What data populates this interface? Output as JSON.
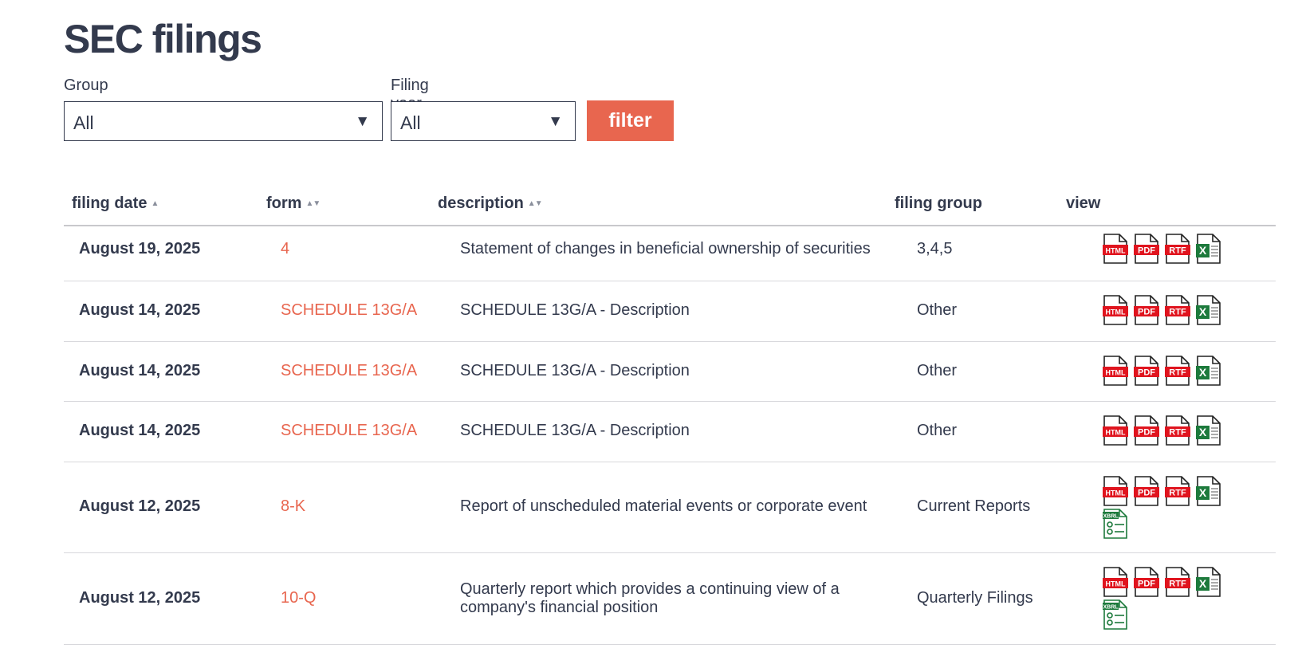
{
  "page": {
    "title": "SEC filings"
  },
  "filters": {
    "group_label": "Group",
    "group_value": "All",
    "year_label": "Filing year",
    "year_value": "All",
    "filter_button": "filter"
  },
  "table": {
    "headers": {
      "date": "filing date",
      "form": "form",
      "description": "description",
      "group": "filing group",
      "view": "view"
    },
    "rows": [
      {
        "date": "August 19, 2025",
        "form": "4",
        "description": "Statement of changes in beneficial ownership of securities",
        "group": "3,4,5",
        "views": [
          "HTML",
          "PDF",
          "RTF",
          "XLS"
        ]
      },
      {
        "date": "August 14, 2025",
        "form": "SCHEDULE 13G/A",
        "description": "SCHEDULE 13G/A - Description",
        "group": "Other",
        "views": [
          "HTML",
          "PDF",
          "RTF",
          "XLS"
        ]
      },
      {
        "date": "August 14, 2025",
        "form": "SCHEDULE 13G/A",
        "description": "SCHEDULE 13G/A - Description",
        "group": "Other",
        "views": [
          "HTML",
          "PDF",
          "RTF",
          "XLS"
        ]
      },
      {
        "date": "August 14, 2025",
        "form": "SCHEDULE 13G/A",
        "description": "SCHEDULE 13G/A - Description",
        "group": "Other",
        "views": [
          "HTML",
          "PDF",
          "RTF",
          "XLS"
        ]
      },
      {
        "date": "August 12, 2025",
        "form": "8-K",
        "description": "Report of unscheduled material events or corporate event",
        "group": "Current Reports",
        "views": [
          "HTML",
          "PDF",
          "RTF",
          "XLS",
          "XBRL"
        ]
      },
      {
        "date": "August 12, 2025",
        "form": "10-Q",
        "description": "Quarterly report which provides a continuing view of a company's financial position",
        "group": "Quarterly Filings",
        "views": [
          "HTML",
          "PDF",
          "RTF",
          "XLS",
          "XBRL"
        ]
      }
    ]
  },
  "icons": {
    "HTML": {
      "name": "html-file-icon",
      "label": "HTML",
      "color": "#e0141e"
    },
    "PDF": {
      "name": "pdf-file-icon",
      "label": "PDF",
      "color": "#e0141e"
    },
    "RTF": {
      "name": "rtf-file-icon",
      "label": "RTF",
      "color": "#e0141e"
    },
    "XLS": {
      "name": "excel-file-icon",
      "label": "X",
      "color": "#1d7a3c"
    },
    "XBRL": {
      "name": "xbrl-file-icon",
      "label": "XBRL",
      "color": "#1d7a3c"
    }
  },
  "colors": {
    "accent": "#e8664f",
    "text": "#333a4d",
    "icon_red": "#e0141e",
    "icon_green": "#1d7a3c"
  }
}
